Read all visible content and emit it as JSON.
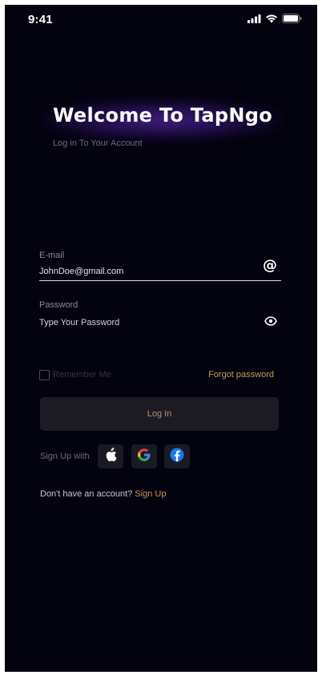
{
  "status_bar": {
    "time": "9:41",
    "icons": [
      "signal-icon",
      "wifi-icon",
      "battery-icon"
    ]
  },
  "header": {
    "title": "Welcome To TapNgo",
    "subtitle": "Log in To Your Account"
  },
  "email": {
    "label": "E-mail",
    "value": "JohnDoe@gmail.com",
    "icon": "at-icon"
  },
  "password": {
    "label": "Password",
    "placeholder": "Type Your Password",
    "icon": "eye-icon"
  },
  "options": {
    "remember_label": "Remember Me",
    "remember_checked": false,
    "forgot_label": "Forgot password"
  },
  "login": {
    "button_label": "Log In"
  },
  "social": {
    "label": "Sign Up with",
    "providers": [
      "apple-icon",
      "google-icon",
      "facebook-icon"
    ]
  },
  "footer": {
    "prompt": "Don't have an account? ",
    "signup_label": "Sign Up"
  },
  "colors": {
    "background": "#03020f",
    "accent": "#c89b4d",
    "button_bg": "#1c1b24",
    "glow": "#692dc8"
  }
}
